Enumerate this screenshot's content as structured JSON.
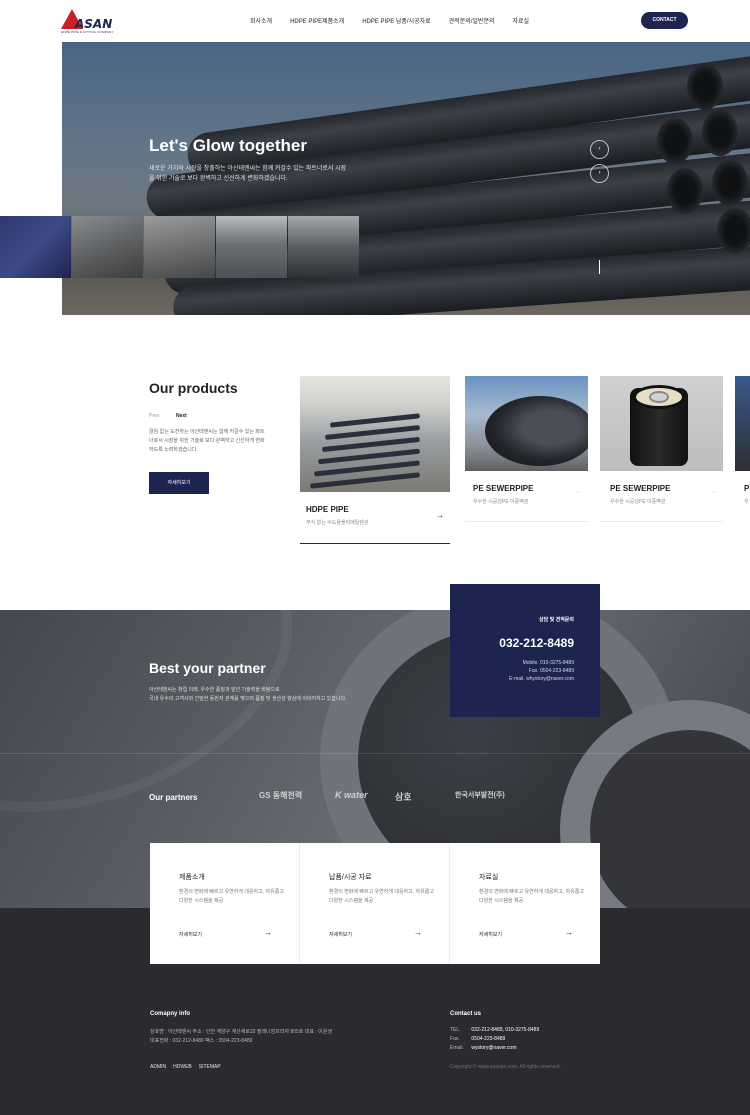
{
  "header": {
    "logo_text": "ASAN",
    "logo_sub": "HDPE PIPE & FITTING COMPANY",
    "nav": [
      "회사소개",
      "HDPE PIPE제품소개",
      "HDPE PIPE 납품/시공자료",
      "견적문의/일반문의",
      "자료실"
    ],
    "contact_label": "CONTACT"
  },
  "hero": {
    "title": "Let's Glow together",
    "desc": "새로운 가치와 시장을 창출하는 아산테앤씨는 함께 커갈수 있는 파트너로서 시장을 위한 기술로 보다 완벽하고 신선하게 변화하겠습니다.",
    "prev_arrow": "‹",
    "next_arrow": "›"
  },
  "products": {
    "title": "Our products",
    "prev": "Prev",
    "next": "Next",
    "desc": "끊임 없는 도전하는 아산테앤씨는 함께 커갈수 있는 파트너로서 시장을 위한 기술로 보다 완벽하고 신선하게 변화하도록 노력하겠습니다.",
    "more": "자세히보기",
    "cards": [
      {
        "title": "HDPE PIPE",
        "sub": "부식 없는 수도용폴리에틸렌관",
        "arrow": "→"
      },
      {
        "title": "PE SEWERPIPE",
        "sub": "우수한 시공성PE 이중벽관",
        "arrow": "→"
      },
      {
        "title": "PE SEWERPIPE",
        "sub": "우수한 시공성PE 이중벽관",
        "arrow": "→"
      },
      {
        "title": "P",
        "sub": "우"
      }
    ]
  },
  "partner": {
    "title": "Best your partner",
    "desc_1": "아산테앤씨는 창립 이래, 우수한 품질과 앞선 기술력을 바탕으로",
    "desc_2": "국내 유수의 고객사와 긴밀한 동반자 관계를 맺으며 품질 및 생산성 향상에 이바지하고 있습니다.",
    "contact_box": {
      "label": "상담 및 견적문의",
      "phone": "032-212-8489",
      "mobile": "Mobile. 010-3275-8489",
      "fax": "Fax. 0504-223-8489",
      "email": "E-mail. whystory@naver.com"
    },
    "partners_label": "Our partners",
    "logos": [
      "GS 동해전력",
      "K water",
      "삼호",
      "한국서부발전(주)"
    ]
  },
  "services": [
    {
      "title": "제품소개",
      "desc": "환경의 변화에 빠르고 유연하게 대응하고, 자유롭고 다양한 시스템을 제공",
      "more": "자세히보기",
      "arrow": "→"
    },
    {
      "title": "납품/시공 자료",
      "desc": "환경의 변화에 빠르고 유연하게 대응하고, 자유롭고 다양한 시스템을 제공",
      "more": "자세히보기",
      "arrow": "→"
    },
    {
      "title": "자료실",
      "desc": "환경의 변화에 빠르고 유연하게 대응하고, 자유롭고 다양한 시스템을 제공",
      "more": "자세히보기",
      "arrow": "→"
    }
  ],
  "footer": {
    "company_heading": "Comapny info",
    "company_line_1": "상호명 : 아산테앤씨 주소 : 인천 계양구 계산새로33 필레니엄프라자 805호 대표 : 이원생",
    "company_line_2": "대표전화 : 032-212-8489   팩스 : 0504-223-8489",
    "links": [
      "ADMIN",
      "HDWEB",
      "SITEMAP"
    ],
    "contact_heading": "Contact us",
    "tel_key": "TEL.",
    "tel": "032-212-8489, 010-3275-8489",
    "fax_key": "Fax.",
    "fax": "0504-223-8489",
    "email_key": "Email.",
    "email": "wystory@naver.com",
    "copyright": "Copyright © www.asanpe.com. All rights reserved."
  },
  "colors": {
    "brand_navy": "#1d2450",
    "logo_red": "#c8202a",
    "footer_dark": "#2a2b2f"
  }
}
